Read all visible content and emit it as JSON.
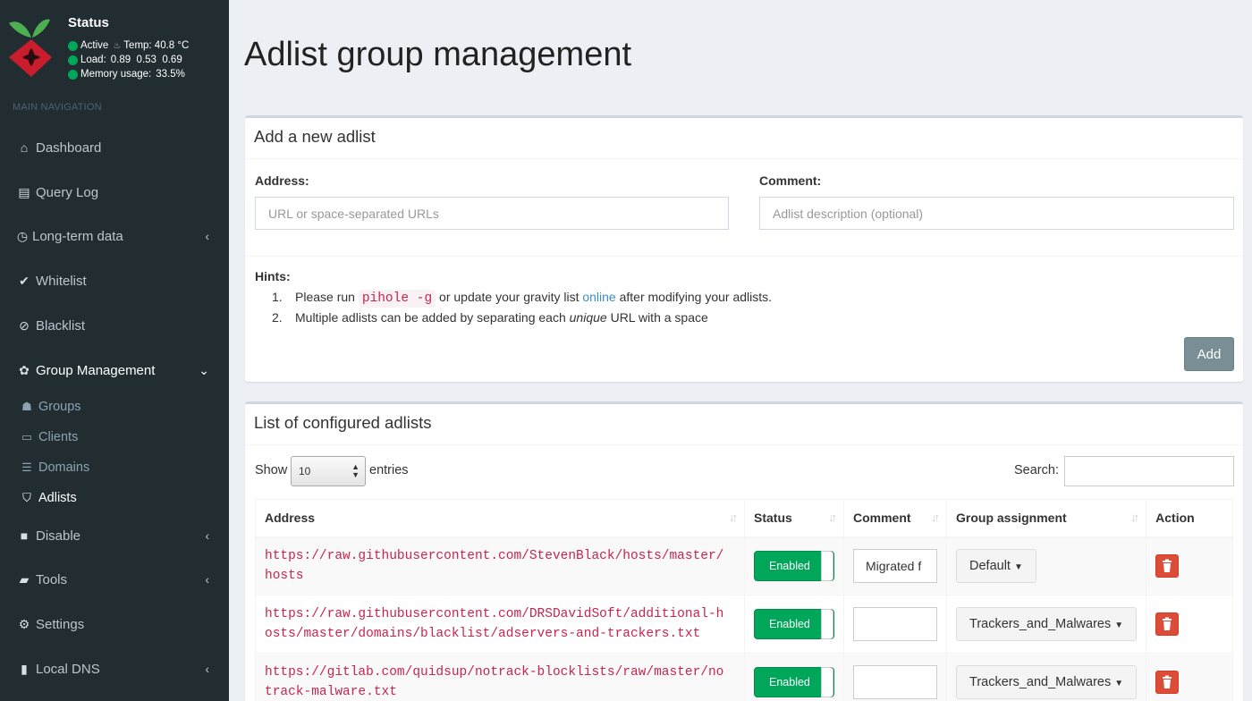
{
  "sidebar": {
    "status_title": "Status",
    "status_active": "Active",
    "temp": "Temp: 40.8 °C",
    "load_label": "Load:",
    "load_values": "0.89  0.53  0.69",
    "memory_label": "Memory usage:",
    "memory_value": "33.5%",
    "nav_header": "MAIN NAVIGATION",
    "items": {
      "dashboard": "Dashboard",
      "query_log": "Query Log",
      "long_term": "Long-term data",
      "whitelist": "Whitelist",
      "blacklist": "Blacklist",
      "group_management": "Group Management",
      "groups": "Groups",
      "clients": "Clients",
      "domains": "Domains",
      "adlists": "Adlists",
      "disable": "Disable",
      "tools": "Tools",
      "settings": "Settings",
      "local_dns": "Local DNS"
    }
  },
  "page": {
    "title": "Adlist group management"
  },
  "add_box": {
    "title": "Add a new adlist",
    "address_label": "Address:",
    "address_placeholder": "URL or space-separated URLs",
    "comment_label": "Comment:",
    "comment_placeholder": "Adlist description (optional)",
    "hints_title": "Hints:",
    "hint1_num": "1.",
    "hint1_a": "Please run",
    "hint1_code": "pihole -g",
    "hint1_b": "or update your gravity list",
    "hint1_link": "online",
    "hint1_c": "after modifying your adlists.",
    "hint2_num": "2.",
    "hint2_a": "Multiple adlists can be added by separating each",
    "hint2_em": "unique",
    "hint2_b": "URL with a space",
    "add_button": "Add"
  },
  "list_box": {
    "title": "List of configured adlists",
    "show_label": "Show",
    "show_value": "10",
    "entries_label": "entries",
    "search_label": "Search:",
    "columns": [
      "Address",
      "Status",
      "Comment",
      "Group assignment",
      "Action"
    ],
    "rows": [
      {
        "url1": "https://raw.githubusercontent.com/StevenBlack/hosts/master/",
        "url2": "hosts",
        "status": "Enabled",
        "comment": "Migrated f",
        "group": "Default"
      },
      {
        "url1": "https://raw.githubusercontent.com/DRSDavidSoft/additional-h",
        "url2": "osts/master/domains/blacklist/adservers-and-trackers.txt",
        "status": "Enabled",
        "comment": "",
        "group": "Trackers_and_Malwares"
      },
      {
        "url1": "https://gitlab.com/quidsup/notrack-blocklists/raw/master/no",
        "url2": "track-malware.txt",
        "status": "Enabled",
        "comment": "",
        "group": "Trackers_and_Malwares"
      }
    ]
  },
  "colors": {
    "sidebar_bg": "#222d32",
    "status_green": "#00a65a",
    "delete_red": "#dd4b39",
    "code_red": "#c7254e",
    "link_blue": "#3c8dbc"
  }
}
